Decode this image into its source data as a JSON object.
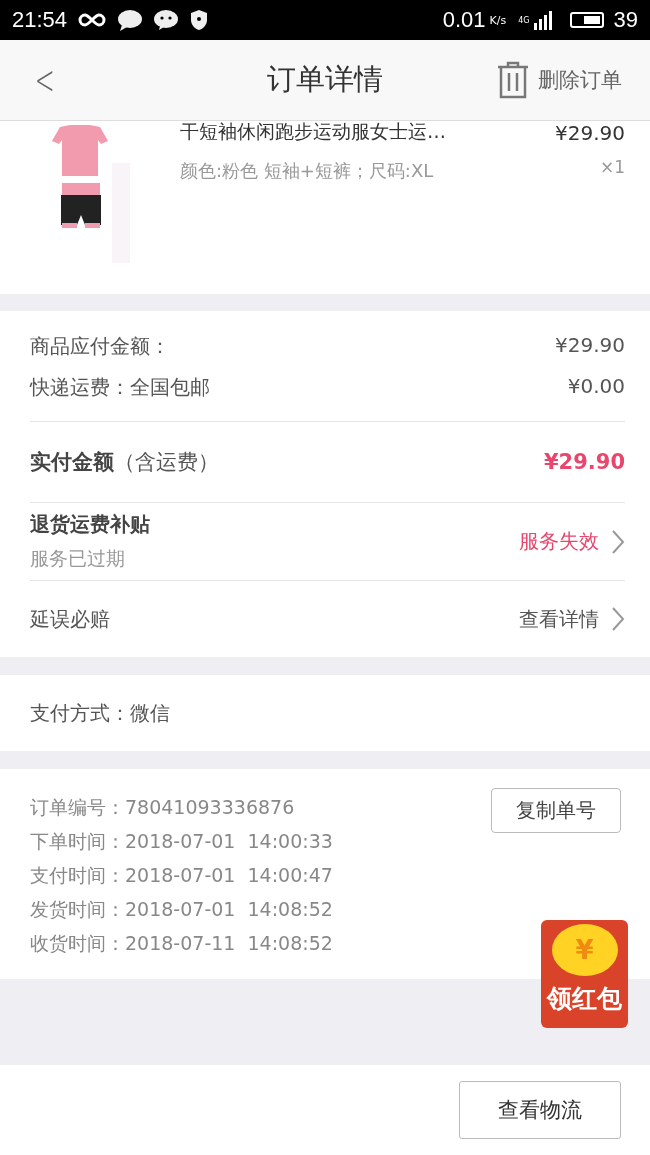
{
  "status_bar": {
    "time": "21:54",
    "speed": "0.01",
    "speed_unit": "K/s",
    "network": "4G",
    "battery": "39"
  },
  "header": {
    "back": "<",
    "title": "订单详情",
    "action": "删除订单"
  },
  "product": {
    "title": "干短袖休闲跑步运动服女士运…",
    "spec": "颜色:粉色  短袖+短裤；尺码:XL",
    "price": "¥29.90",
    "qty": "×1"
  },
  "amounts": [
    {
      "label": "商品应付金额：",
      "value": "¥29.90"
    },
    {
      "label": "快递运费：全国包邮",
      "value": "¥0.00"
    }
  ],
  "total": {
    "label": "实付金额",
    "note": "（含运费）",
    "value": "¥29.90"
  },
  "services": [
    {
      "title": "退货运费补贴",
      "subtitle": "服务已过期",
      "status": "服务失效",
      "highlight": true
    },
    {
      "title": "延误必赔",
      "status": "查看详情",
      "highlight": false
    }
  ],
  "payment": {
    "label": "支付方式：微信"
  },
  "order_info": {
    "lines": [
      "订单编号：78041093336876",
      "下单时间：2018-07-01  14:00:33",
      "支付时间：2018-07-01  14:00:47",
      "发货时间：2018-07-01  14:08:52",
      "收货时间：2018-07-11  14:08:52"
    ],
    "copy_button": "复制单号"
  },
  "red_packet": {
    "label": "领红包",
    "coin": "¥"
  },
  "footer": {
    "button": "查看物流"
  }
}
